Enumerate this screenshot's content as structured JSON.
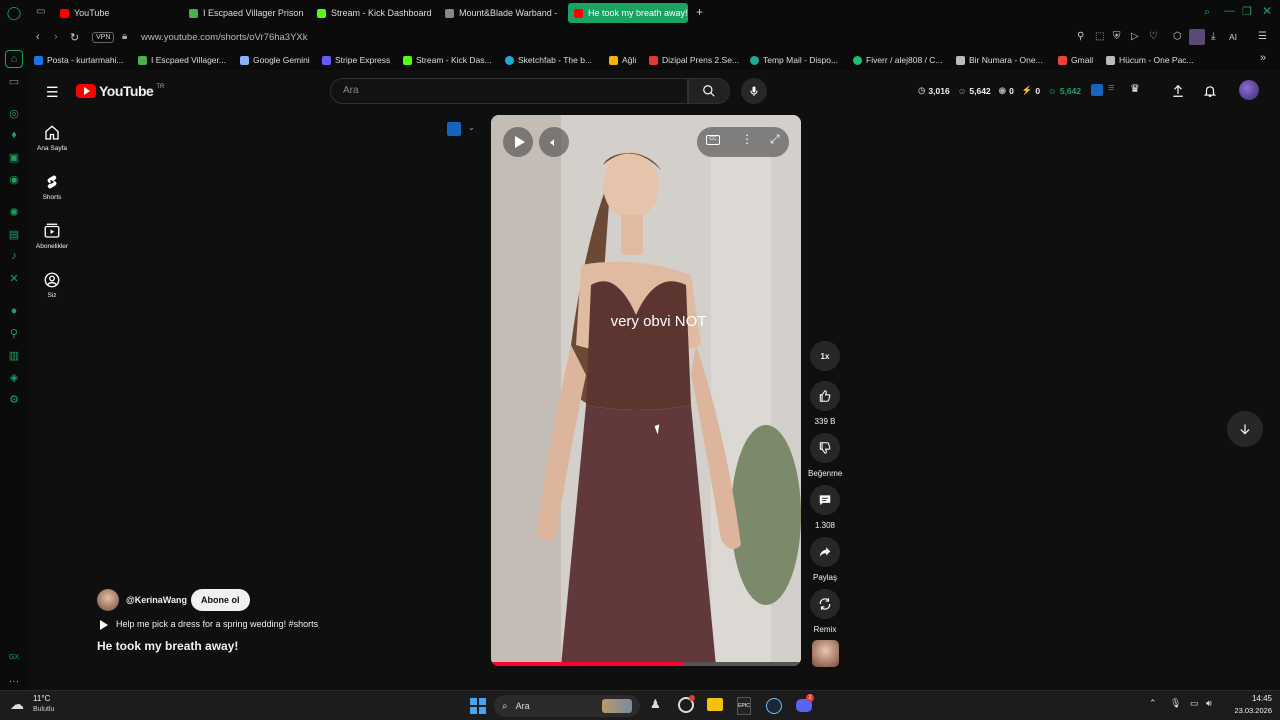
{
  "browser": {
    "tabs": [
      {
        "label": "YouTube",
        "color": "#ff0000"
      },
      {
        "label": "I Escpaed Villager Prison",
        "color": "#4caf50"
      },
      {
        "label": "Stream - Kick Dashboard",
        "color": "#53fc18"
      },
      {
        "label": "Mount&Blade Warband - T",
        "color": "#888888"
      },
      {
        "label": "He took my breath away!",
        "color": "#ff0000"
      }
    ],
    "new_tab": "+",
    "vpn_label": "VPN",
    "url": "www.youtube.com/shorts/oVr76ha3YXk",
    "ai_label": "AI",
    "bookmarks": [
      {
        "label": "Posta - kurtarmahi...",
        "color": "#1a73e8"
      },
      {
        "label": "I Escpaed Villager...",
        "color": "#4caf50"
      },
      {
        "label": "Google Gemini",
        "color": "#8ab4f8"
      },
      {
        "label": "Stripe Express",
        "color": "#635bff"
      },
      {
        "label": "Stream - Kick Das...",
        "color": "#53fc18"
      },
      {
        "label": "Sketchfab - The b...",
        "color": "#1caad9"
      },
      {
        "label": "Ağlı",
        "color": "#f4b400"
      },
      {
        "label": "Dizipal Prens 2.Se...",
        "color": "#e53935"
      },
      {
        "label": "Temp Mail - Dispo...",
        "color": "#26a69a"
      },
      {
        "label": "Fiverr / alej808 / C...",
        "color": "#1dbf73"
      },
      {
        "label": "Bir Numara - One...",
        "color": "#bbbbbb"
      },
      {
        "label": "Gmail",
        "color": "#ea4335"
      },
      {
        "label": "Hücum - One Pac...",
        "color": "#bbbbbb"
      }
    ]
  },
  "youtube": {
    "logo_text": "YouTube",
    "logo_region": "TR",
    "guide": [
      {
        "label": "Ana Sayfa",
        "icon": "home-icon"
      },
      {
        "label": "Shorts",
        "icon": "shorts-icon"
      },
      {
        "label": "Abonelikler",
        "icon": "subscriptions-icon"
      },
      {
        "label": "Siz",
        "icon": "you-icon"
      }
    ],
    "search_placeholder": "Ara",
    "stats": {
      "views": "3,016",
      "subs": "5,642",
      "s1": "0",
      "s2": "0",
      "s3": "5,642"
    },
    "short": {
      "overlay_text": "very obvi NOT",
      "channel": "@KerinaWang",
      "subscribe_label": "Abone ol",
      "description": "Help me pick a dress for a spring wedding! #shorts",
      "title": "He took my breath away!"
    },
    "actions": {
      "speed": "1x",
      "likes": "339 B",
      "dislike_label": "Beğenme",
      "comments": "1.308",
      "share_label": "Paylaş",
      "remix_label": "Remix"
    }
  },
  "taskbar": {
    "temp": "11°C",
    "weather": "Bulutlu",
    "search_label": "Ara",
    "time": "14:45",
    "date": "23.03.2026",
    "discord_badge": "2"
  },
  "colors": {
    "accent": "#1aa260",
    "yt_red": "#ff0000",
    "bg": "#0f0f0f"
  }
}
